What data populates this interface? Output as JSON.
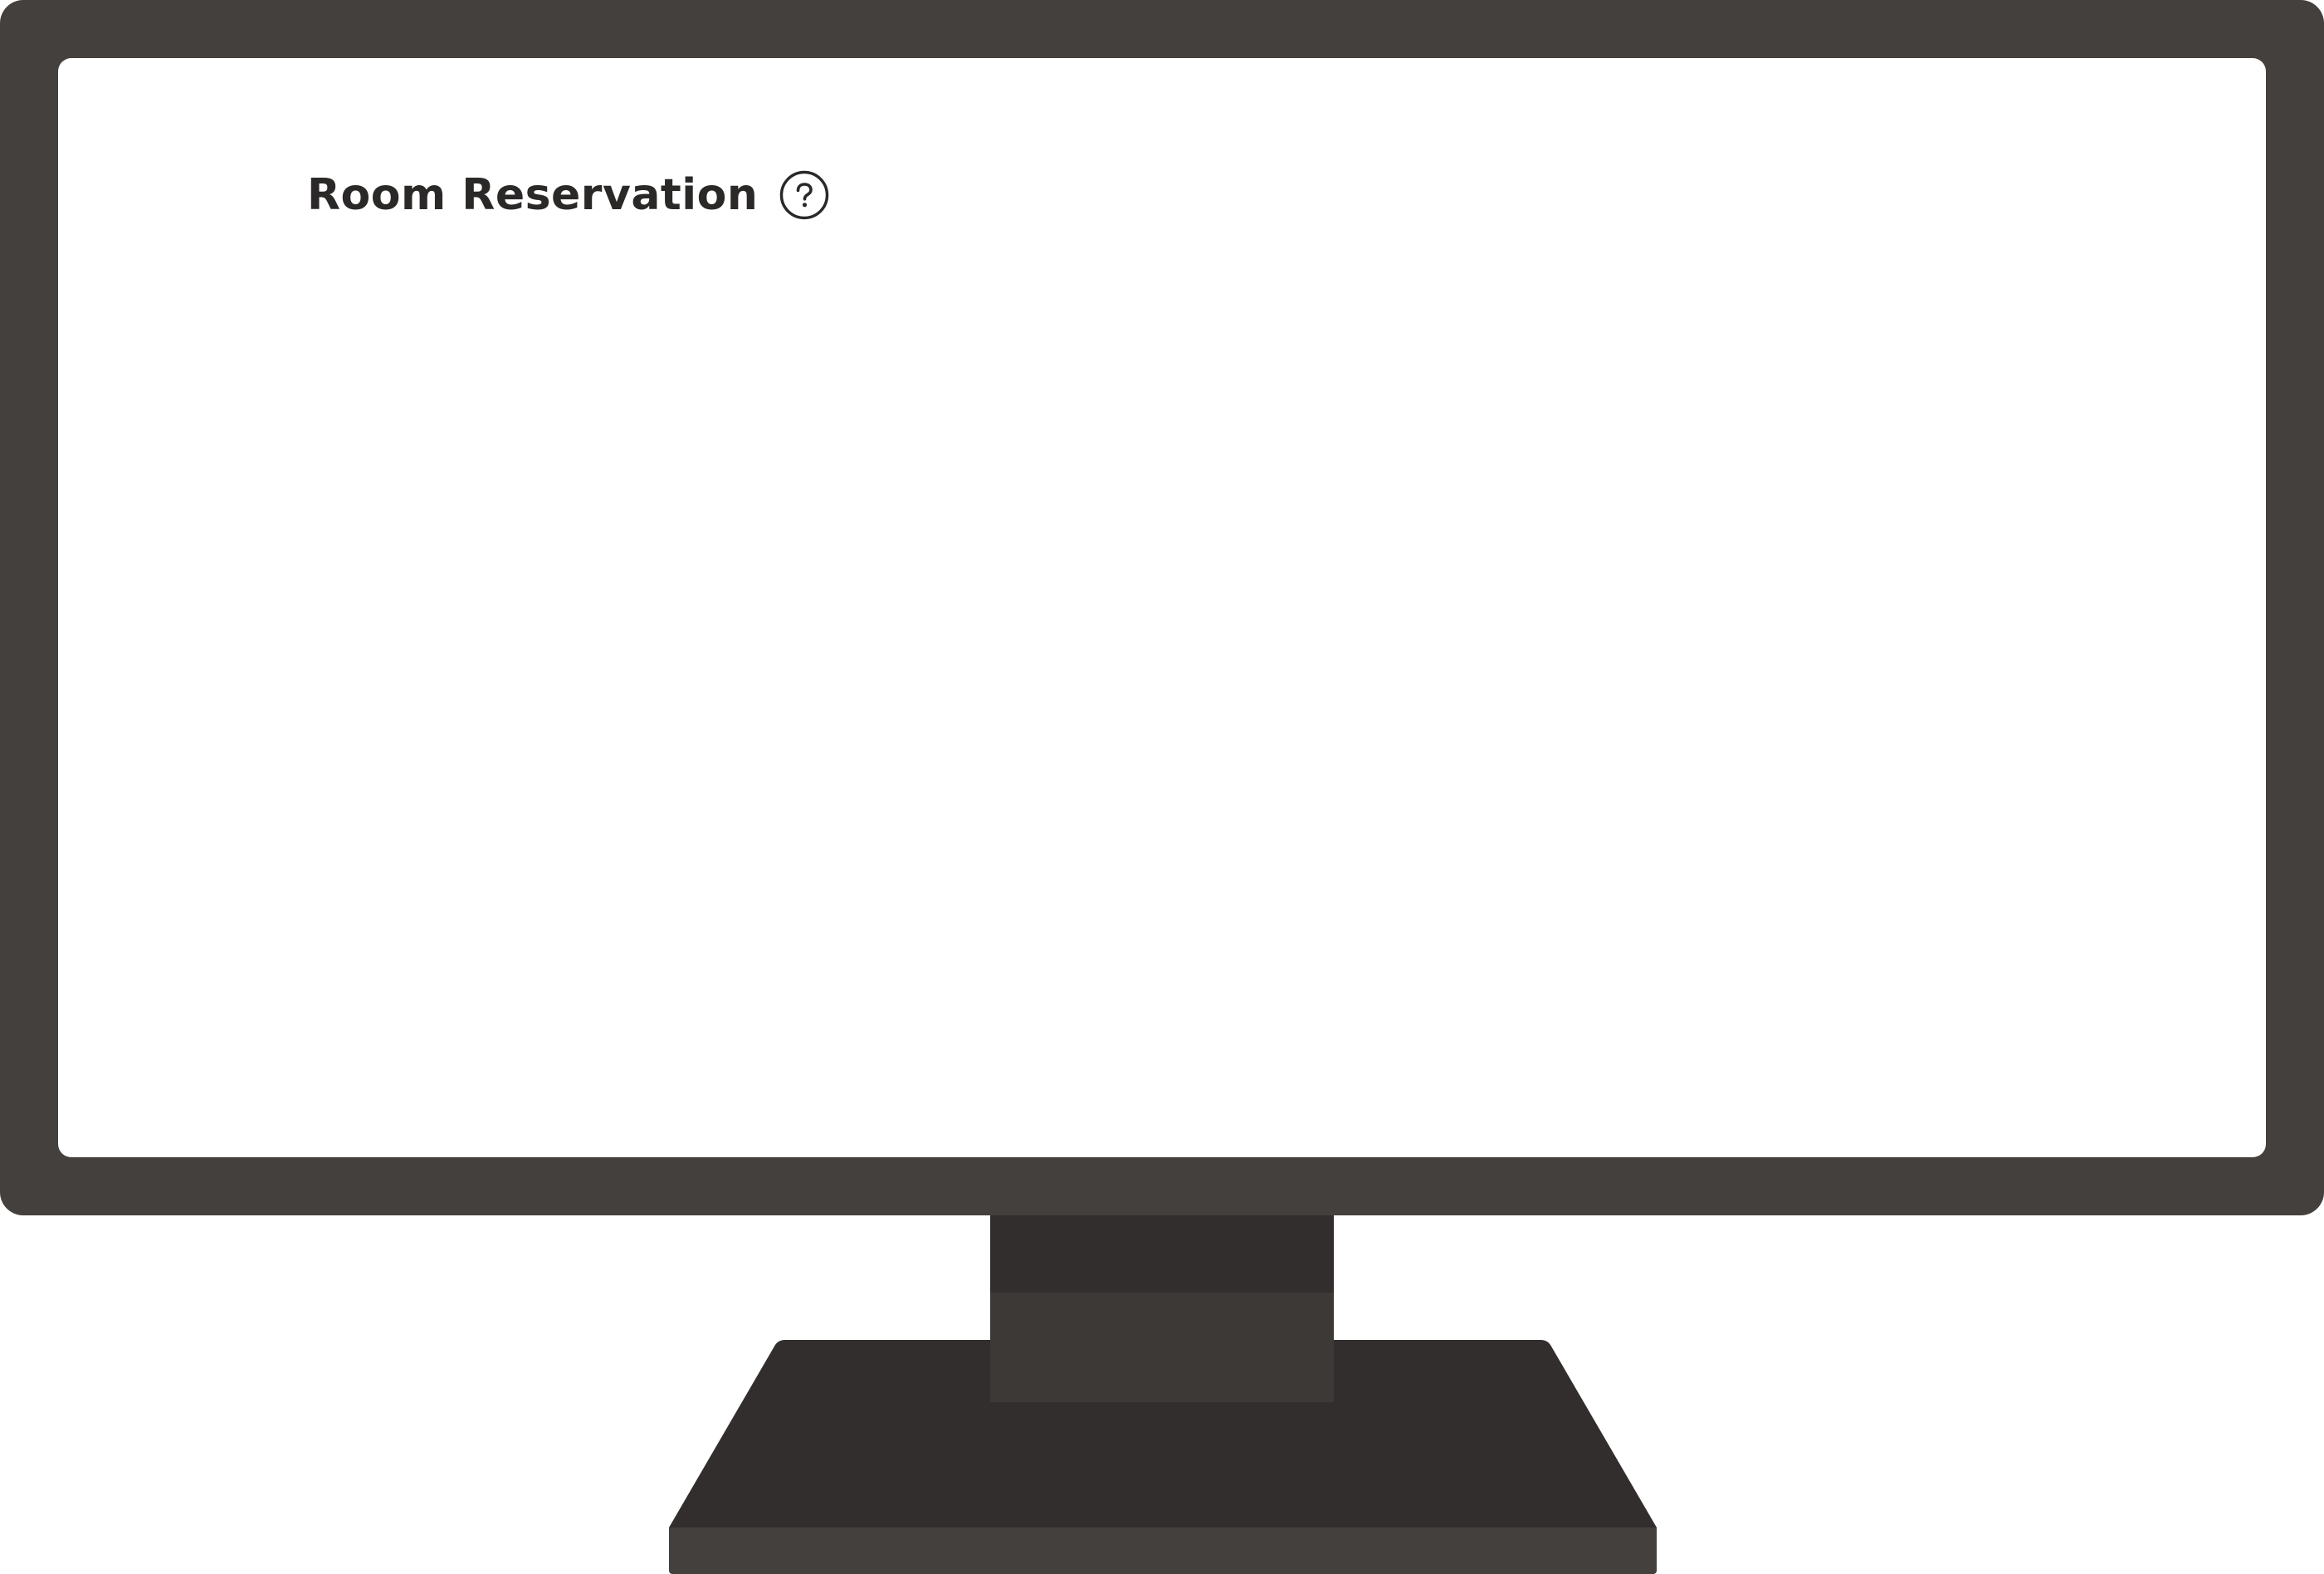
{
  "page": {
    "title": "Room Reservation"
  },
  "icons": {
    "help": "question-circle-icon"
  },
  "colors": {
    "bezel": "#44403e",
    "stand_dark": "#322e2d",
    "stand_mid": "#3d3937",
    "screen": "#ffffff",
    "text": "#2b2928"
  }
}
